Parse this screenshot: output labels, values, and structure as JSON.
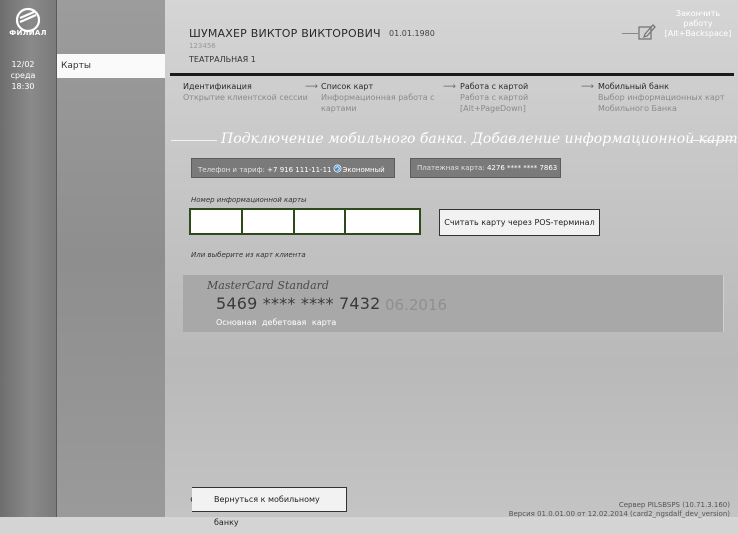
{
  "sidebar": {
    "logo_text": "ФИЛИАЛ",
    "date": "12/02",
    "weekday": "среда",
    "time": "18:30",
    "nav_active": "Карты"
  },
  "header": {
    "client_name": "ШУМАХЕР ВИКТОР ВИКТОРОВИЧ",
    "birth_date": "01.01.1980",
    "client_id": "123456",
    "address": "ТЕАТРАЛЬНАЯ 1",
    "finish_line1": "Закончить",
    "finish_line2": "работу",
    "finish_line3": "[Alt+Backspace]"
  },
  "steps": [
    {
      "title": "Идентификация",
      "sub1": "Открытие клиентской сессии",
      "sub2": "",
      "sub3": ""
    },
    {
      "title": "Список карт",
      "sub1": "Информационная работа с",
      "sub2": "картами",
      "sub3": ""
    },
    {
      "title": "Работа с картой",
      "sub1": "Работа с картой",
      "sub2": "[Alt+PageDown]",
      "sub3": ""
    },
    {
      "title": "Мобильный банк",
      "sub1": "Выбор информационных карт",
      "sub2": "Мобильного Банка",
      "sub3": ""
    }
  ],
  "section_title": "Подключение мобильного банка. Добавление информационной карты",
  "phone_chip": {
    "label": "Телефон и тариф:",
    "phone": "+7 916 111-11-11",
    "tariff": "Экономный"
  },
  "payment_chip": {
    "label": "Платежная карта:",
    "number": "4276 **** **** 7863"
  },
  "info_card": {
    "label": "Номер информационной карты",
    "values": [
      "",
      "",
      "",
      ""
    ]
  },
  "pos_button": "Считать карту через POS-терминал",
  "or_choose_label": "Или выберите из карт клиента",
  "client_card": {
    "type": "MasterCard Standard",
    "number": "5469 **** **** 7432",
    "expiry": "06.2016",
    "description": "Основная дебетовая карта"
  },
  "back_button": "Вернуться к мобильному банку",
  "footer": {
    "server": "Сервер PILSBSPS (10.71.3.160)",
    "version": "Версия 01.0.01.00 от 12.02.2014 (card2_ngsdalf_dev_version)"
  }
}
